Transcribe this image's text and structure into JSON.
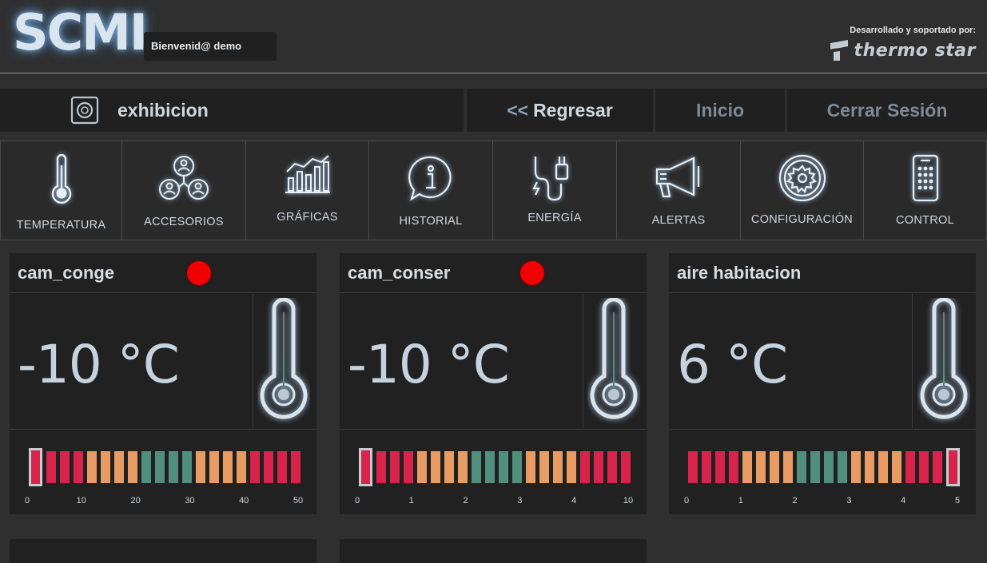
{
  "header": {
    "logo": "SCMI",
    "welcome": "Bienvenid@ demo",
    "developed_by": "Desarrollado y soportado por:",
    "brand": "thermo star"
  },
  "nav": {
    "site": "exhibicion",
    "back": "Regresar",
    "back_arrows": "<<",
    "home": "Inicio",
    "logout": "Cerrar Sesión"
  },
  "toolbar": [
    {
      "label": "TEMPERATURA",
      "icon": "thermometer-icon"
    },
    {
      "label": "ACCESORIOS",
      "icon": "accessories-icon"
    },
    {
      "label": "GRÁFICAS",
      "icon": "bar-chart-icon"
    },
    {
      "label": "HISTORIAL",
      "icon": "info-bubble-icon"
    },
    {
      "label": "ENERGÍA",
      "icon": "power-plug-icon"
    },
    {
      "label": "ALERTAS",
      "icon": "megaphone-icon"
    },
    {
      "label": "CONFIGURACIÓN",
      "icon": "gear-icon"
    },
    {
      "label": "CONTROL",
      "icon": "remote-control-icon"
    }
  ],
  "cards": [
    {
      "name": "cam_conge",
      "alarm": true,
      "temperature": "-10 °C",
      "scale_ticks": [
        "0",
        "10",
        "20",
        "30",
        "40",
        "50"
      ],
      "selected_bar": 0
    },
    {
      "name": "cam_conser",
      "alarm": true,
      "temperature": "-10 °C",
      "scale_ticks": [
        "0",
        "1",
        "2",
        "3",
        "4",
        "10"
      ],
      "selected_bar": 0
    },
    {
      "name": "aire habitacion",
      "alarm": false,
      "temperature": "6 °C",
      "scale_ticks": [
        "0",
        "1",
        "2",
        "3",
        "4",
        "5"
      ],
      "selected_bar": 19
    }
  ],
  "colors": {
    "red_zone": "#d8234a",
    "orange_zone": "#e89b62",
    "green_zone": "#4f8f7c",
    "alarm_led": "#f00000"
  }
}
